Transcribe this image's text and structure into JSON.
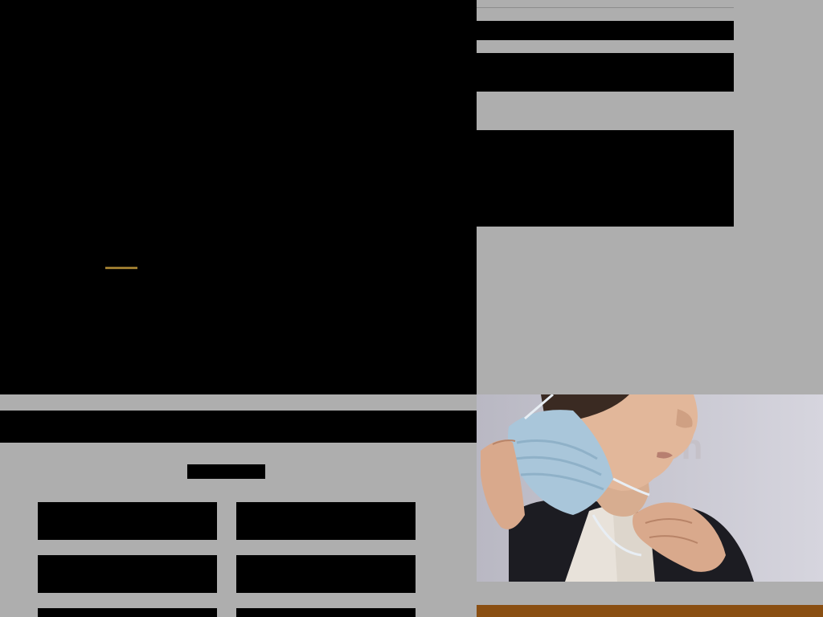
{
  "hero": {
    "title": "",
    "subtitle": ""
  },
  "sidebar": {
    "line1": "",
    "line2": "",
    "block": ""
  },
  "section": {
    "banner": "",
    "label": ""
  },
  "tiles": [
    "",
    "",
    "",
    "",
    "",
    ""
  ],
  "colors": {
    "accent": "#9b7a2f",
    "footer_strip": "#8a4f12",
    "page_bg": "#aeaeae"
  }
}
